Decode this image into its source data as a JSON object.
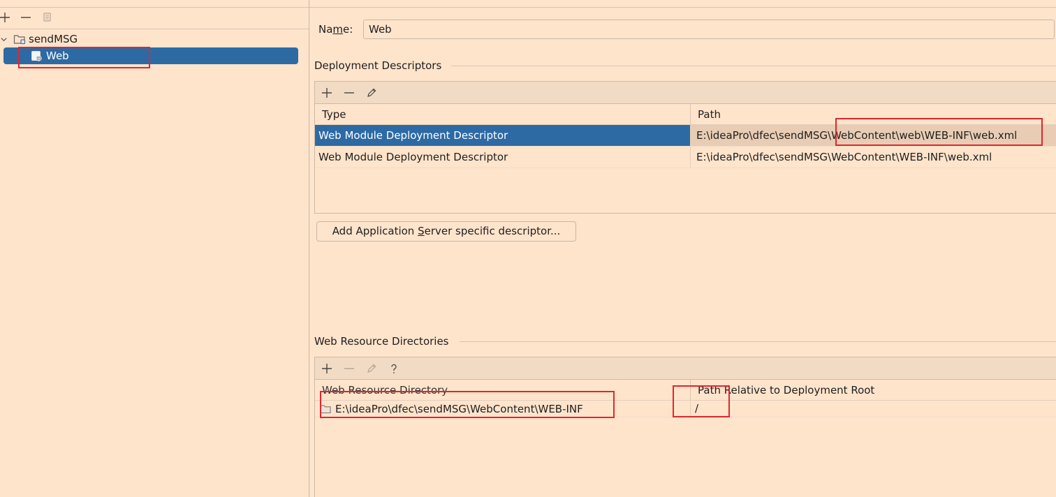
{
  "left_toolbar": {
    "add_icon": "plus-icon",
    "remove_icon": "minus-icon",
    "copy_icon": "copy-icon"
  },
  "tree": {
    "module": {
      "label": "sendMSG",
      "icon": "module-folder-icon",
      "expanded": true
    },
    "facet": {
      "label": "Web",
      "icon": "web-facet-icon",
      "selected": true
    }
  },
  "facet_settings": {
    "name_label_prefix": "Na",
    "name_label_mnemonic": "m",
    "name_label_suffix": "e:",
    "name_value": "Web"
  },
  "deployment_descriptors": {
    "title": "Deployment Descriptors",
    "toolbar": [
      "plus-icon",
      "minus-icon",
      "edit-icon"
    ],
    "columns": [
      "Type",
      "Path"
    ],
    "rows": [
      {
        "type": "Web Module Deployment Descriptor",
        "path": "E:\\ideaPro\\dfec\\sendMSG\\WebContent\\web\\WEB-INF\\web.xml",
        "selected": true
      },
      {
        "type": "Web Module Deployment Descriptor",
        "path": "E:\\ideaPro\\dfec\\sendMSG\\WebContent\\WEB-INF\\web.xml",
        "selected": false
      }
    ],
    "add_button": {
      "prefix": "Add Application ",
      "mnemonic": "S",
      "suffix": "erver specific descriptor..."
    }
  },
  "web_resource_directories": {
    "title": "Web Resource Directories",
    "toolbar": [
      "plus-icon",
      "minus-icon",
      "edit-icon",
      "help-icon"
    ],
    "columns": [
      "Web Resource Directory",
      "Path Relative to Deployment Root"
    ],
    "rows": [
      {
        "directory": "E:\\ideaPro\\dfec\\sendMSG\\WebContent\\WEB-INF",
        "relative_path": "/",
        "icon": "folder-icon"
      }
    ]
  },
  "colors": {
    "background": "#ffe4cc",
    "selection": "#2d6aa4",
    "annotation": "#e0262f"
  }
}
